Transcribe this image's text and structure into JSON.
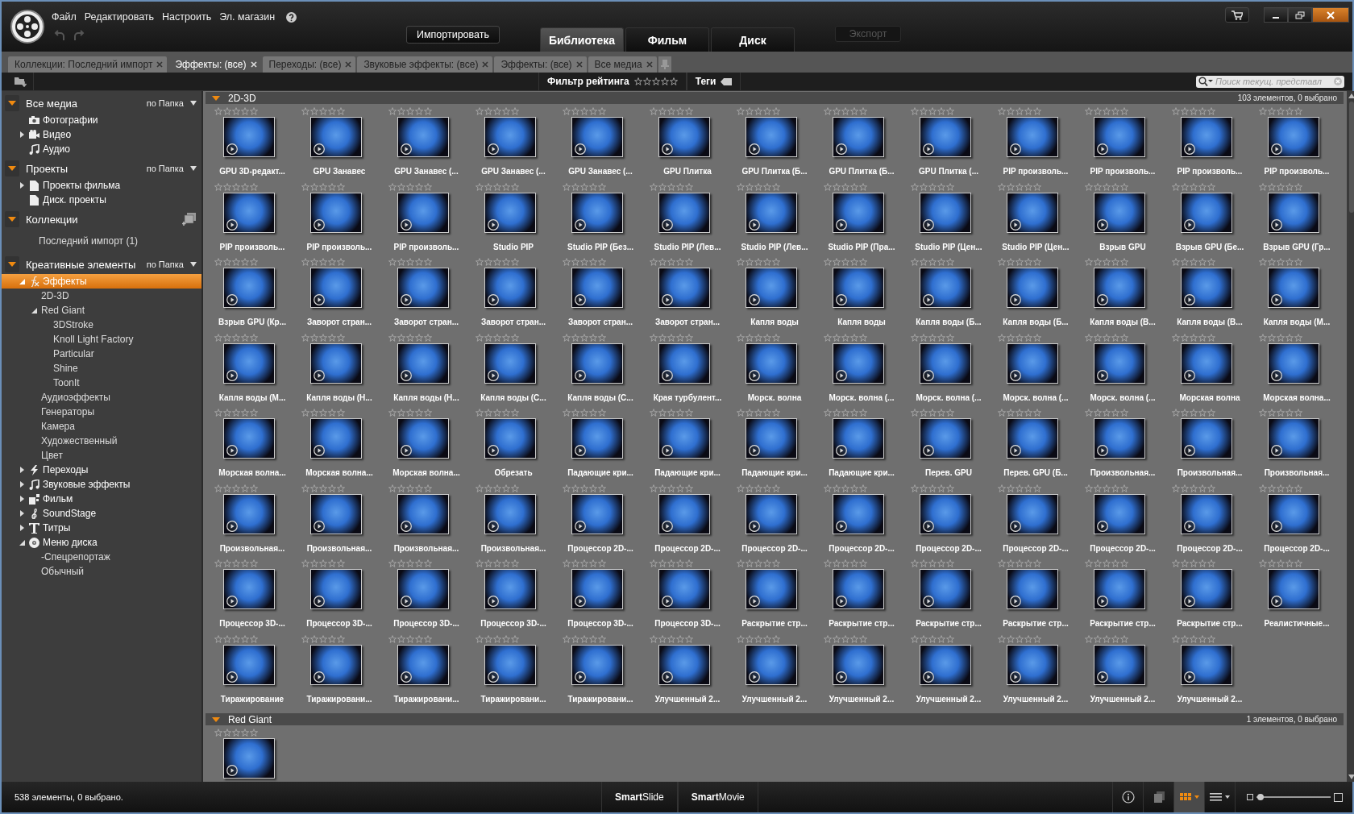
{
  "menu": [
    "Файл",
    "Редактировать",
    "Настроить",
    "Эл. магазин"
  ],
  "import_button": {
    "label": "Импортировать"
  },
  "main_tabs": [
    {
      "label": "Библиотека",
      "selected": true
    },
    {
      "label": "Фильм",
      "selected": false
    },
    {
      "label": "Диск",
      "selected": false
    }
  ],
  "export_button": {
    "label": "Экспорт",
    "disabled": true
  },
  "collection_tabs": [
    {
      "label": "Коллекции: Последний импорт",
      "selected": false
    },
    {
      "label": "Эффекты: (все)",
      "selected": true
    },
    {
      "label": "Переходы: (все)",
      "selected": false
    },
    {
      "label": "Звуковые эффекты: (все)",
      "selected": false
    },
    {
      "label": "Эффекты: (все)",
      "selected": false
    },
    {
      "label": "Все медиа",
      "selected": false
    }
  ],
  "filter_bar": {
    "rating_label": "Фильтр рейтинга",
    "stars": 0,
    "tags_label": "Теги",
    "search": {
      "placeholder": "Поиск текущ. представл"
    }
  },
  "sidebar": {
    "sections": [
      {
        "title": "Все медиа",
        "expanded": true,
        "kind": "sort",
        "sort": "по Папка",
        "items": [
          {
            "label": "Фотографии",
            "kind": "photo",
            "selected": false
          },
          {
            "label": "Видео",
            "kind": "video",
            "expanded": false,
            "selected": false
          },
          {
            "label": "Аудио",
            "kind": "music",
            "selected": false
          }
        ]
      },
      {
        "title": "Проекты",
        "expanded": true,
        "kind": "sort",
        "sort": "по Папка",
        "items": [
          {
            "label": "Проекты фильма",
            "kind": "doc",
            "expanded": false,
            "selected": false
          },
          {
            "label": "Диск. проекты",
            "kind": "doc",
            "selected": false
          }
        ]
      },
      {
        "title": "Коллекции",
        "expanded": true,
        "kind": "add",
        "items": [
          {
            "label": "Последний импорт  (1)",
            "selected": false
          }
        ]
      },
      {
        "title": "Креативные элементы",
        "expanded": true,
        "kind": "sort",
        "sort": "по Папка",
        "items": [
          {
            "label": "Эффекты",
            "kind": "fx",
            "expanded": true,
            "selected": true,
            "children": [
              {
                "label": "2D-3D",
                "selected": false
              },
              {
                "label": "Red Giant",
                "expanded": true,
                "selected": false,
                "children": [
                  {
                    "label": "3DStroke",
                    "selected": false
                  },
                  {
                    "label": "Knoll Light Factory",
                    "selected": false
                  },
                  {
                    "label": "Particular",
                    "selected": false
                  },
                  {
                    "label": "Shine",
                    "selected": false
                  },
                  {
                    "label": "ToonIt",
                    "selected": false
                  }
                ]
              },
              {
                "label": "Аудиоэффекты",
                "selected": false
              },
              {
                "label": "Генераторы",
                "selected": false
              },
              {
                "label": "Камера",
                "selected": false
              },
              {
                "label": "Художественный",
                "selected": false
              },
              {
                "label": "Цвет",
                "selected": false
              }
            ]
          },
          {
            "label": "Переходы",
            "kind": "bolt",
            "expanded": false,
            "selected": false
          },
          {
            "label": "Звуковые эффекты",
            "kind": "music",
            "expanded": false,
            "selected": false
          },
          {
            "label": "Фильм",
            "kind": "film",
            "expanded": false,
            "selected": false
          },
          {
            "label": "SoundStage",
            "kind": "clef",
            "expanded": false,
            "selected": false
          },
          {
            "label": "Титры",
            "kind": "title",
            "expanded": false,
            "selected": false
          },
          {
            "label": "Меню диска",
            "kind": "disc",
            "expanded": true,
            "selected": false,
            "children": [
              {
                "label": "-Спецрепортаж",
                "selected": false
              },
              {
                "label": "Обычный",
                "selected": false
              }
            ]
          }
        ]
      }
    ]
  },
  "groups": [
    {
      "title": "2D-3D",
      "expanded": true,
      "count": "103 элементов, 0 выбрано",
      "items": [
        {
          "label": "GPU 3D-редакт...",
          "stars": 0
        },
        {
          "label": "GPU Занавес",
          "stars": 0
        },
        {
          "label": "GPU Занавес (...",
          "stars": 0
        },
        {
          "label": "GPU Занавес (...",
          "stars": 0
        },
        {
          "label": "GPU Занавес (...",
          "stars": 0
        },
        {
          "label": "GPU Плитка",
          "stars": 0
        },
        {
          "label": "GPU Плитка (Б...",
          "stars": 0
        },
        {
          "label": "GPU Плитка (Б...",
          "stars": 0
        },
        {
          "label": "GPU Плитка (...",
          "stars": 0
        },
        {
          "label": "PIP произволь...",
          "stars": 0
        },
        {
          "label": "PIP произволь...",
          "stars": 0
        },
        {
          "label": "PIP произволь...",
          "stars": 0
        },
        {
          "label": "PIP произволь...",
          "stars": 0
        },
        {
          "label": "PIP произволь...",
          "stars": 0
        },
        {
          "label": "PIP произволь...",
          "stars": 0
        },
        {
          "label": "PIP произволь...",
          "stars": 0
        },
        {
          "label": "Studio PIP",
          "stars": 0
        },
        {
          "label": "Studio PIP (Без...",
          "stars": 0
        },
        {
          "label": "Studio PIP (Лев...",
          "stars": 0
        },
        {
          "label": "Studio PIP (Лев...",
          "stars": 0
        },
        {
          "label": "Studio PIP (Пра...",
          "stars": 0
        },
        {
          "label": "Studio PIP (Цен...",
          "stars": 0
        },
        {
          "label": "Studio PIP (Цен...",
          "stars": 0
        },
        {
          "label": "Взрыв GPU",
          "stars": 0
        },
        {
          "label": "Взрыв GPU (Бе...",
          "stars": 0
        },
        {
          "label": "Взрыв GPU (Гр...",
          "stars": 0
        },
        {
          "label": "Взрыв GPU (Кр...",
          "stars": 0
        },
        {
          "label": "Заворот стран...",
          "stars": 0
        },
        {
          "label": "Заворот стран...",
          "stars": 0
        },
        {
          "label": "Заворот стран...",
          "stars": 0
        },
        {
          "label": "Заворот стран...",
          "stars": 0
        },
        {
          "label": "Заворот стран...",
          "stars": 0
        },
        {
          "label": "Капля воды",
          "stars": 0
        },
        {
          "label": "Капля воды",
          "stars": 0
        },
        {
          "label": "Капля воды (Б...",
          "stars": 0
        },
        {
          "label": "Капля воды (Б...",
          "stars": 0
        },
        {
          "label": "Капля воды (В...",
          "stars": 0
        },
        {
          "label": "Капля воды (В...",
          "stars": 0
        },
        {
          "label": "Капля воды (М...",
          "stars": 0
        },
        {
          "label": "Капля воды (М...",
          "stars": 0
        },
        {
          "label": "Капля воды (Н...",
          "stars": 0
        },
        {
          "label": "Капля воды (Н...",
          "stars": 0
        },
        {
          "label": "Капля воды (С...",
          "stars": 0
        },
        {
          "label": "Капля воды (С...",
          "stars": 0
        },
        {
          "label": "Края турбулент...",
          "stars": 0
        },
        {
          "label": "Морск. волна",
          "stars": 0
        },
        {
          "label": "Морск. волна (...",
          "stars": 0
        },
        {
          "label": "Морск. волна (...",
          "stars": 0
        },
        {
          "label": "Морск. волна (...",
          "stars": 0
        },
        {
          "label": "Морск. волна (...",
          "stars": 0
        },
        {
          "label": "Морская волна",
          "stars": 0
        },
        {
          "label": "Морская волна...",
          "stars": 0
        },
        {
          "label": "Морская волна...",
          "stars": 0
        },
        {
          "label": "Морская волна...",
          "stars": 0
        },
        {
          "label": "Морская волна...",
          "stars": 0
        },
        {
          "label": "Обрезать",
          "stars": 0
        },
        {
          "label": "Падающие кри...",
          "stars": 0
        },
        {
          "label": "Падающие кри...",
          "stars": 0
        },
        {
          "label": "Падающие кри...",
          "stars": 0
        },
        {
          "label": "Падающие кри...",
          "stars": 0
        },
        {
          "label": "Перев. GPU",
          "stars": 0
        },
        {
          "label": "Перев. GPU (Б...",
          "stars": 0
        },
        {
          "label": "Произвольная...",
          "stars": 0
        },
        {
          "label": "Произвольная...",
          "stars": 0
        },
        {
          "label": "Произвольная...",
          "stars": 0
        },
        {
          "label": "Произвольная...",
          "stars": 0
        },
        {
          "label": "Произвольная...",
          "stars": 0
        },
        {
          "label": "Произвольная...",
          "stars": 0
        },
        {
          "label": "Произвольная...",
          "stars": 0
        },
        {
          "label": "Процессор 2D-...",
          "stars": 0
        },
        {
          "label": "Процессор 2D-...",
          "stars": 0
        },
        {
          "label": "Процессор 2D-...",
          "stars": 0
        },
        {
          "label": "Процессор 2D-...",
          "stars": 0
        },
        {
          "label": "Процессор 2D-...",
          "stars": 0
        },
        {
          "label": "Процессор 2D-...",
          "stars": 0
        },
        {
          "label": "Процессор 2D-...",
          "stars": 0
        },
        {
          "label": "Процессор 2D-...",
          "stars": 0
        },
        {
          "label": "Процессор 2D-...",
          "stars": 0
        },
        {
          "label": "Процессор 3D-...",
          "stars": 0
        },
        {
          "label": "Процессор 3D-...",
          "stars": 0
        },
        {
          "label": "Процессор 3D-...",
          "stars": 0
        },
        {
          "label": "Процессор 3D-...",
          "stars": 0
        },
        {
          "label": "Процессор 3D-...",
          "stars": 0
        },
        {
          "label": "Процессор 3D-...",
          "stars": 0
        },
        {
          "label": "Раскрытие стр...",
          "stars": 0
        },
        {
          "label": "Раскрытие стр...",
          "stars": 0
        },
        {
          "label": "Раскрытие стр...",
          "stars": 0
        },
        {
          "label": "Раскрытие стр...",
          "stars": 0
        },
        {
          "label": "Раскрытие стр...",
          "stars": 0
        },
        {
          "label": "Раскрытие стр...",
          "stars": 0
        },
        {
          "label": "Реалистичные...",
          "stars": 0
        },
        {
          "label": "Тиражирование",
          "stars": 0
        },
        {
          "label": "Тиражировани...",
          "stars": 0
        },
        {
          "label": "Тиражировани...",
          "stars": 0
        },
        {
          "label": "Тиражировани...",
          "stars": 0
        },
        {
          "label": "Тиражировани...",
          "stars": 0
        },
        {
          "label": "Улучшенный 2...",
          "stars": 0
        },
        {
          "label": "Улучшенный 2...",
          "stars": 0
        },
        {
          "label": "Улучшенный 2...",
          "stars": 0
        },
        {
          "label": "Улучшенный 2...",
          "stars": 0
        },
        {
          "label": "Улучшенный 2...",
          "stars": 0
        },
        {
          "label": "Улучшенный 2...",
          "stars": 0
        },
        {
          "label": "Улучшенный 2...",
          "stars": 0
        }
      ]
    },
    {
      "title": "Red Giant",
      "expanded": true,
      "count": "1 элементов, 0 выбрано",
      "items": [
        {
          "stars": 0
        }
      ]
    }
  ],
  "status_bar": {
    "text": "538 элементы, 0 выбрано.",
    "smart_buttons": [
      "**Smart**Slide",
      "**Smart**Movie"
    ],
    "view_modes": [
      {
        "kind": "grid",
        "selected": true
      },
      {
        "kind": "list",
        "selected": false
      }
    ],
    "zoom": {
      "level": 0.05
    }
  }
}
